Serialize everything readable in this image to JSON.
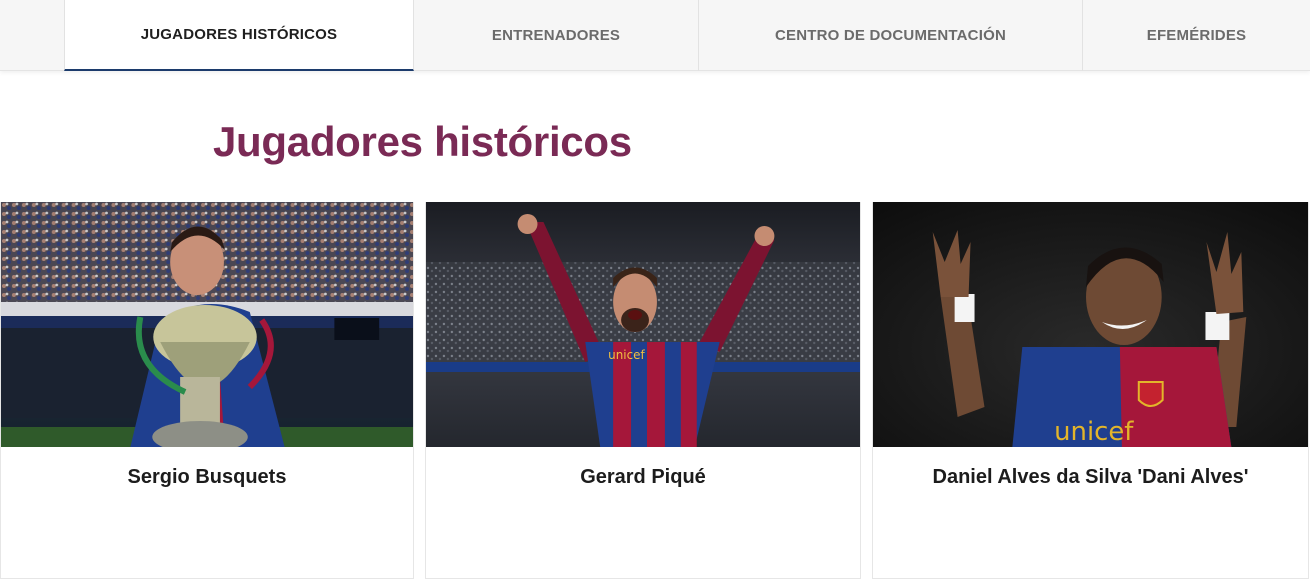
{
  "tabs": [
    {
      "label": "JUGADORES HISTÓRICOS",
      "active": true
    },
    {
      "label": "ENTRENADORES",
      "active": false
    },
    {
      "label": "CENTRO DE DOCUMENTACIÓN",
      "active": false
    },
    {
      "label": "EFEMÉRIDES",
      "active": false
    }
  ],
  "page_title": "Jugadores históricos",
  "players": [
    {
      "name": "Sergio Busquets",
      "shirt_text": "",
      "photo": "player-holding-trophy-in-stadium"
    },
    {
      "name": "Gerard Piqué",
      "shirt_text": "unicef",
      "photo": "player-celebrating-arms-raised"
    },
    {
      "name": "Daniel Alves da Silva 'Dani Alves'",
      "shirt_text": "unicef",
      "photo": "player-smiling-hands-raised"
    }
  ],
  "colors": {
    "title": "#7a2a55",
    "active_tab_underline": "#1c3b6c",
    "tab_inactive_text": "#6b6b6b",
    "tab_active_text": "#1f1f1f",
    "blaugrana_blue": "#1f3f8f",
    "blaugrana_red": "#a5173a"
  }
}
